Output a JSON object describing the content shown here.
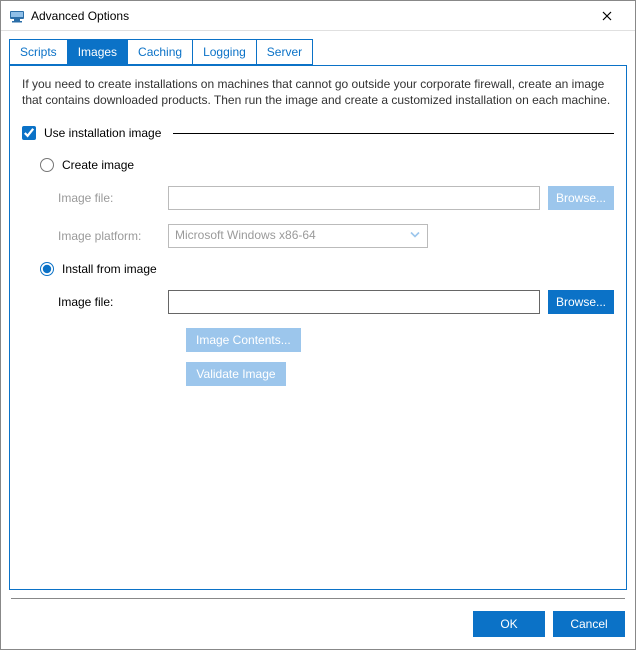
{
  "window": {
    "title": "Advanced Options"
  },
  "tabs": {
    "scripts": "Scripts",
    "images": "Images",
    "caching": "Caching",
    "logging": "Logging",
    "server": "Server"
  },
  "panel": {
    "intro": "If you need to create installations on machines that cannot go outside your corporate firewall, create an image that contains downloaded products. Then run the image and create a customized installation on each machine.",
    "useInstallationImage": "Use installation image",
    "createImage": {
      "label": "Create image",
      "imageFileLabel": "Image file:",
      "imageFileValue": "",
      "browse": "Browse...",
      "platformLabel": "Image platform:",
      "platformValue": "Microsoft Windows x86-64"
    },
    "installFromImage": {
      "label": "Install from image",
      "imageFileLabel": "Image file:",
      "imageFileValue": "",
      "browse": "Browse...",
      "imageContents": "Image Contents...",
      "validateImage": "Validate Image"
    }
  },
  "footer": {
    "ok": "OK",
    "cancel": "Cancel"
  }
}
